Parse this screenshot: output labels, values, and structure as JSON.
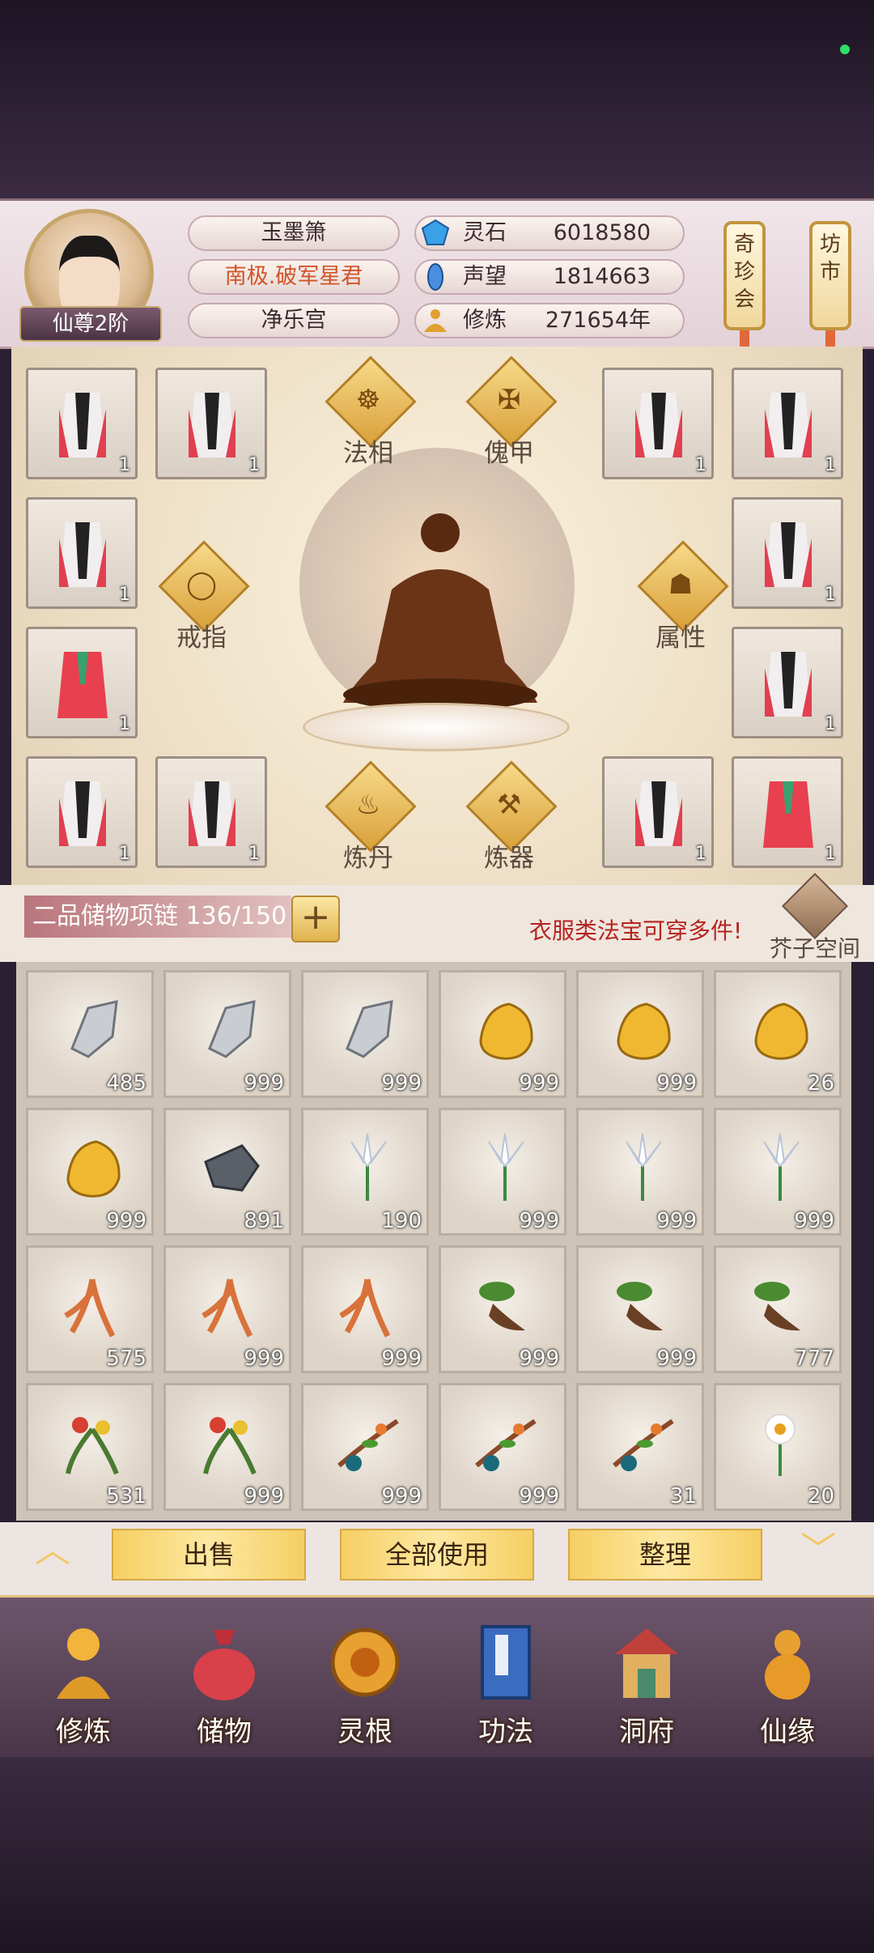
{
  "header": {
    "player_name": "玉墨箫",
    "title": "南极.破军星君",
    "sect": "净乐宫",
    "rank": "仙尊2阶",
    "resources": [
      {
        "label": "灵石",
        "value": "6018580",
        "icon": "spirit-stone-icon",
        "color": "#3aa0e8"
      },
      {
        "label": "声望",
        "value": "1814663",
        "icon": "reputation-icon",
        "color": "#4a8ee0"
      },
      {
        "label": "修炼",
        "value": "271654年",
        "icon": "cultivation-icon",
        "color": "#e0a030"
      }
    ],
    "shops": [
      "奇珍会",
      "坊市"
    ]
  },
  "equipment": {
    "slots_left": [
      {
        "count": "1",
        "type": "robe-white"
      },
      {
        "count": "1",
        "type": "robe-white"
      },
      {
        "count": "1",
        "type": "robe-white"
      },
      {
        "count": "1",
        "type": "robe-red"
      },
      {
        "count": "1",
        "type": "robe-white"
      },
      {
        "count": "1",
        "type": "robe-white"
      }
    ],
    "slots_right": [
      {
        "count": "1",
        "type": "robe-white"
      },
      {
        "count": "1",
        "type": "robe-white"
      },
      {
        "count": "1",
        "type": "robe-white"
      },
      {
        "count": "1",
        "type": "robe-white"
      },
      {
        "count": "1",
        "type": "robe-white"
      },
      {
        "count": "1",
        "type": "robe-red"
      }
    ],
    "functions": {
      "faxiang": "法相",
      "kuijia": "傀甲",
      "jiezhi": "戒指",
      "shuxing": "属性",
      "liandan": "炼丹",
      "lianqi": "炼器"
    }
  },
  "storage": {
    "title": "二品储物项链 136/150",
    "hint": "衣服类法宝可穿多件!",
    "mustard_space": "芥子空间",
    "items": [
      {
        "type": "iron-ore",
        "count": "485"
      },
      {
        "type": "iron-ore",
        "count": "999"
      },
      {
        "type": "iron-ore",
        "count": "999"
      },
      {
        "type": "gold-ore",
        "count": "999"
      },
      {
        "type": "gold-ore",
        "count": "999"
      },
      {
        "type": "gold-ore",
        "count": "26"
      },
      {
        "type": "gold-ore",
        "count": "999"
      },
      {
        "type": "dark-ore",
        "count": "891"
      },
      {
        "type": "white-lily",
        "count": "190"
      },
      {
        "type": "white-lily",
        "count": "999"
      },
      {
        "type": "white-lily",
        "count": "999"
      },
      {
        "type": "white-lily",
        "count": "999"
      },
      {
        "type": "ginseng",
        "count": "575"
      },
      {
        "type": "ginseng",
        "count": "999"
      },
      {
        "type": "ginseng",
        "count": "999"
      },
      {
        "type": "root-herb",
        "count": "999"
      },
      {
        "type": "root-herb",
        "count": "999"
      },
      {
        "type": "root-herb",
        "count": "777"
      },
      {
        "type": "red-flower-herb",
        "count": "531"
      },
      {
        "type": "red-flower-herb",
        "count": "999"
      },
      {
        "type": "berry-branch",
        "count": "999"
      },
      {
        "type": "berry-branch",
        "count": "999"
      },
      {
        "type": "berry-branch",
        "count": "31"
      },
      {
        "type": "daisy",
        "count": "20"
      }
    ]
  },
  "actions": {
    "sell": "出售",
    "use_all": "全部使用",
    "sort": "整理"
  },
  "nav": [
    {
      "label": "修炼",
      "icon": "cultivation-monk-icon"
    },
    {
      "label": "储物",
      "icon": "storage-bag-icon"
    },
    {
      "label": "灵根",
      "icon": "spirit-root-icon"
    },
    {
      "label": "功法",
      "icon": "scripture-book-icon"
    },
    {
      "label": "洞府",
      "icon": "cave-house-icon"
    },
    {
      "label": "仙缘",
      "icon": "gourd-icon"
    }
  ]
}
